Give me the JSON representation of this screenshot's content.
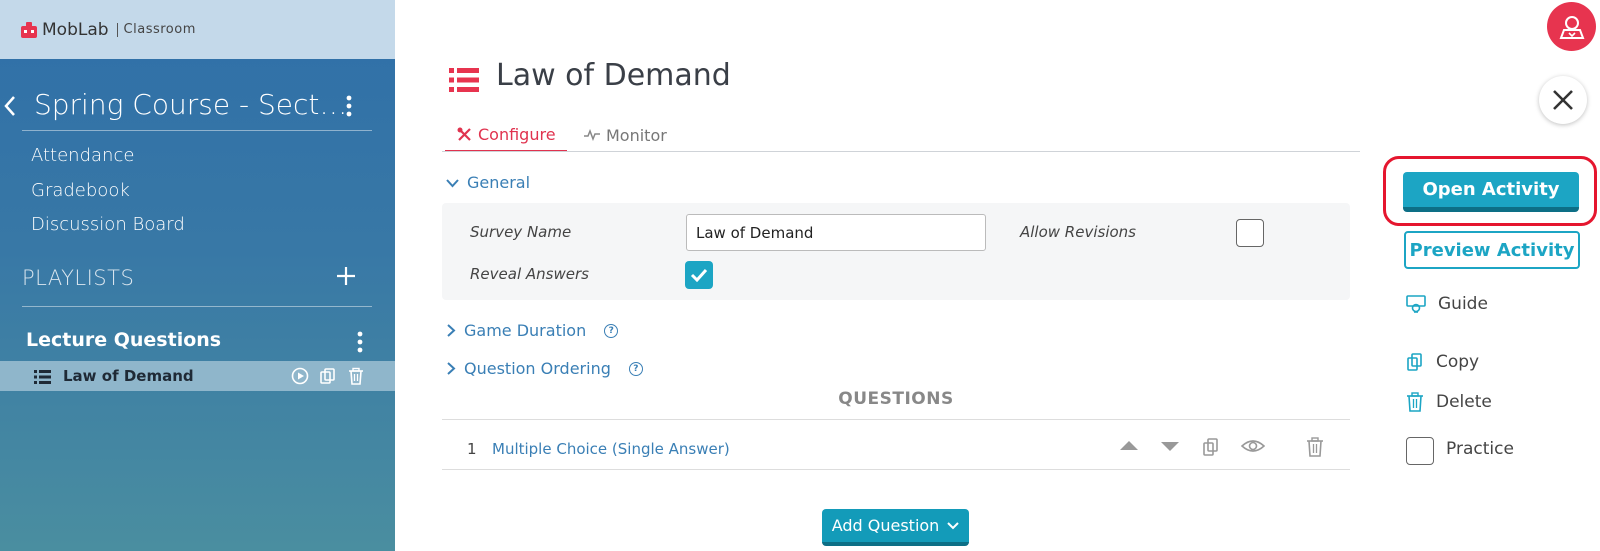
{
  "brand": {
    "name": "MobLab",
    "product": "Classroom",
    "accent": "#e7344f"
  },
  "sidebar": {
    "course_title": "Spring Course - Sect…",
    "nav": [
      {
        "label": "Attendance"
      },
      {
        "label": "Gradebook"
      },
      {
        "label": "Discussion Board"
      }
    ],
    "playlists_label": "PLAYLISTS",
    "playlist": {
      "title": "Lecture Questions",
      "items": [
        {
          "label": "Law of Demand",
          "icon": "list-icon",
          "actions": [
            "play-icon",
            "copy-icon",
            "trash-icon"
          ]
        }
      ]
    }
  },
  "main": {
    "title": "Law of Demand",
    "title_icon": "list-icon",
    "tabs": [
      {
        "label": "Configure",
        "icon": "tools-icon",
        "active": true
      },
      {
        "label": "Monitor",
        "icon": "activity-icon",
        "active": false
      }
    ],
    "sections": {
      "general": {
        "label": "General",
        "expanded": true
      },
      "game_duration": {
        "label": "Game Duration",
        "expanded": false
      },
      "question_ordering": {
        "label": "Question Ordering",
        "expanded": false
      }
    },
    "form": {
      "survey_name_label": "Survey Name",
      "survey_name_value": "Law of Demand",
      "allow_revisions_label": "Allow Revisions",
      "allow_revisions_checked": false,
      "reveal_answers_label": "Reveal Answers",
      "reveal_answers_checked": true
    },
    "questions": {
      "header": "QUESTIONS",
      "items": [
        {
          "number": "1",
          "type": "Multiple Choice (Single Answer)"
        }
      ]
    },
    "add_question_label": "Add Question"
  },
  "right_panel": {
    "open_activity_label": "Open Activity",
    "preview_activity_label": "Preview Activity",
    "guide_label": "Guide",
    "copy_label": "Copy",
    "delete_label": "Delete",
    "practice_label": "Practice",
    "practice_checked": false,
    "highlight_color": "#e5162f",
    "button_color": "#1ca5c4"
  }
}
